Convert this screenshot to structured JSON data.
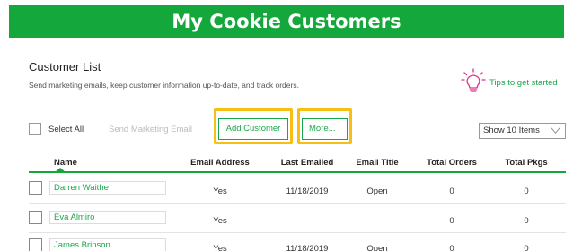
{
  "header": {
    "title": "My Cookie Customers"
  },
  "list": {
    "title": "Customer List",
    "subtitle": "Send marketing emails, keep customer information up-to-date, and track orders."
  },
  "tips": {
    "label": "Tips to get started"
  },
  "toolbar": {
    "select_all": "Select All",
    "send_email": "Send Marketing Email",
    "add_customer": "Add Customer",
    "more": "More...",
    "show_items": "Show 10 Items"
  },
  "columns": {
    "name": "Name",
    "email": "Email Address",
    "last_emailed": "Last Emailed",
    "email_title": "Email Title",
    "total_orders": "Total Orders",
    "total_pkgs": "Total Pkgs"
  },
  "rows": [
    {
      "name": "Darren Waithe",
      "email": "Yes",
      "last_emailed": "11/18/2019",
      "email_title": "Open",
      "orders": "0",
      "pkgs": "0"
    },
    {
      "name": "Eva Almiro",
      "email": "Yes",
      "last_emailed": "",
      "email_title": "",
      "orders": "0",
      "pkgs": "0"
    },
    {
      "name": "James Brinson",
      "email": "Yes",
      "last_emailed": "11/18/2019",
      "email_title": "Open",
      "orders": "0",
      "pkgs": "0"
    }
  ],
  "colors": {
    "brand": "#14a83c",
    "highlight": "#f7be15",
    "tips_icon": "#e0308c"
  },
  "icons": {
    "tips": "lightbulb-icon",
    "dropdown": "chevron-down-icon"
  }
}
